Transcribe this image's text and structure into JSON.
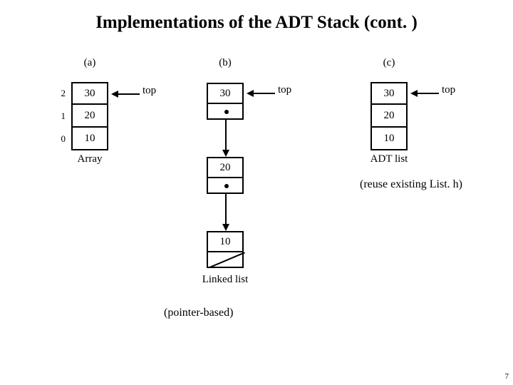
{
  "title": "Implementations of the ADT Stack (cont. )",
  "labels": {
    "top": "top"
  },
  "panels": {
    "a": {
      "tag": "(a)",
      "indices": [
        "2",
        "1",
        "0"
      ],
      "values": [
        "30",
        "20",
        "10"
      ],
      "caption": "Array"
    },
    "b": {
      "tag": "(b)",
      "nodes": [
        "30",
        "20",
        "10"
      ],
      "caption": "Linked list",
      "note": "(pointer-based)"
    },
    "c": {
      "tag": "(c)",
      "values": [
        "30",
        "20",
        "10"
      ],
      "caption": "ADT list",
      "note": "(reuse existing List. h)"
    }
  },
  "page_number": "7"
}
